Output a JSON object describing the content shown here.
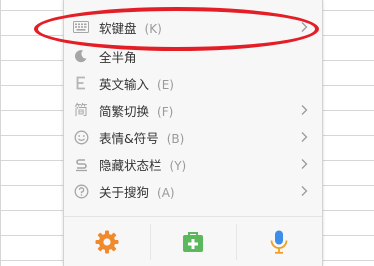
{
  "menu": {
    "items": [
      {
        "label": "软键盘",
        "shortcut": "(K)",
        "icon": "keyboard-icon",
        "submenu": true
      },
      {
        "label": "全半角",
        "shortcut": "",
        "icon": "moon-icon",
        "submenu": false
      },
      {
        "label": "英文输入",
        "shortcut": "(E)",
        "icon": "letter-e-icon",
        "submenu": false
      },
      {
        "label": "简繁切换",
        "shortcut": "(F)",
        "icon": "jian-char-icon",
        "icon_text": "简",
        "submenu": true
      },
      {
        "label": "表情&符号",
        "shortcut": "(B)",
        "icon": "smiley-icon",
        "submenu": true
      },
      {
        "label": "隐藏状态栏",
        "shortcut": "(Y)",
        "icon": "hide-statusbar-icon",
        "submenu": true
      },
      {
        "label": "关于搜狗",
        "shortcut": "(A)",
        "icon": "help-circle-icon",
        "submenu": true
      }
    ],
    "bottom_buttons": [
      {
        "name": "settings",
        "icon": "gear-icon",
        "color": "#f08a2c"
      },
      {
        "name": "toolbox",
        "icon": "toolbox-icon",
        "color": "#5cb85c"
      },
      {
        "name": "voice",
        "icon": "microphone-icon",
        "color": "#3d8ee8"
      }
    ]
  },
  "colors": {
    "annotation": "#e41e26",
    "icon_gray": "#a6a6a6",
    "text": "#333333",
    "shortcut": "#9a9a9a"
  }
}
